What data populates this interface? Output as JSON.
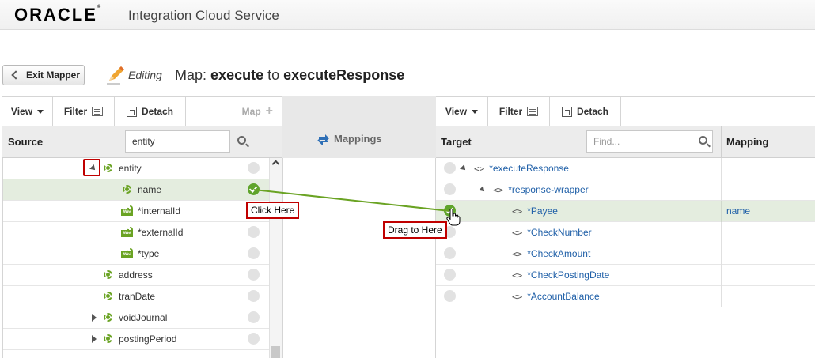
{
  "header": {
    "brand": "ORACLE",
    "app_title": "Integration Cloud Service"
  },
  "titlebar": {
    "exit_label": "Exit Mapper",
    "mode": "Editing",
    "map_prefix": "Map:",
    "map_source": "execute",
    "map_to": "to",
    "map_target": "executeResponse"
  },
  "source_toolbar": {
    "view": "View",
    "filter": "Filter",
    "detach": "Detach",
    "map": "Map"
  },
  "target_toolbar": {
    "view": "View",
    "filter": "Filter",
    "detach": "Detach"
  },
  "source": {
    "header": "Source",
    "search_value": "entity",
    "rows": [
      {
        "label": "entity",
        "icon": "element-icon",
        "expanded": true,
        "mapped": false
      },
      {
        "label": "name",
        "icon": "element-icon",
        "mapped": true,
        "highlighted": true
      },
      {
        "label": "*internalId",
        "icon": "attribute-icon",
        "mapped": false
      },
      {
        "label": "*externalId",
        "icon": "attribute-icon",
        "mapped": false
      },
      {
        "label": "*type",
        "icon": "attribute-icon",
        "mapped": false
      },
      {
        "label": "address",
        "icon": "element-icon",
        "mapped": false
      },
      {
        "label": "tranDate",
        "icon": "element-icon",
        "mapped": false
      },
      {
        "label": "voidJournal",
        "icon": "element-icon",
        "collapsed": true,
        "mapped": false
      },
      {
        "label": "postingPeriod",
        "icon": "element-icon",
        "collapsed": true,
        "mapped": false
      }
    ]
  },
  "mappings": {
    "label": "Mappings"
  },
  "target": {
    "header": "Target",
    "search_placeholder": "Find...",
    "mapping_header": "Mapping",
    "rows": [
      {
        "label": "*executeResponse",
        "mapping": "",
        "mapped": false
      },
      {
        "label": "*response-wrapper",
        "mapping": "",
        "mapped": false
      },
      {
        "label": "*Payee",
        "mapping": "name",
        "mapped": true,
        "highlighted": true
      },
      {
        "label": "*CheckNumber",
        "mapping": "",
        "mapped": false
      },
      {
        "label": "*CheckAmount",
        "mapping": "",
        "mapped": false
      },
      {
        "label": "*CheckPostingDate",
        "mapping": "",
        "mapped": false
      },
      {
        "label": "*AccountBalance",
        "mapping": "",
        "mapped": false
      }
    ]
  },
  "callouts": {
    "click_here": "Click Here",
    "drag_to_here": "Drag to Here"
  },
  "colors": {
    "accent_green": "#5fa42b",
    "callout_red": "#c00000",
    "link_blue": "#2060a8"
  }
}
